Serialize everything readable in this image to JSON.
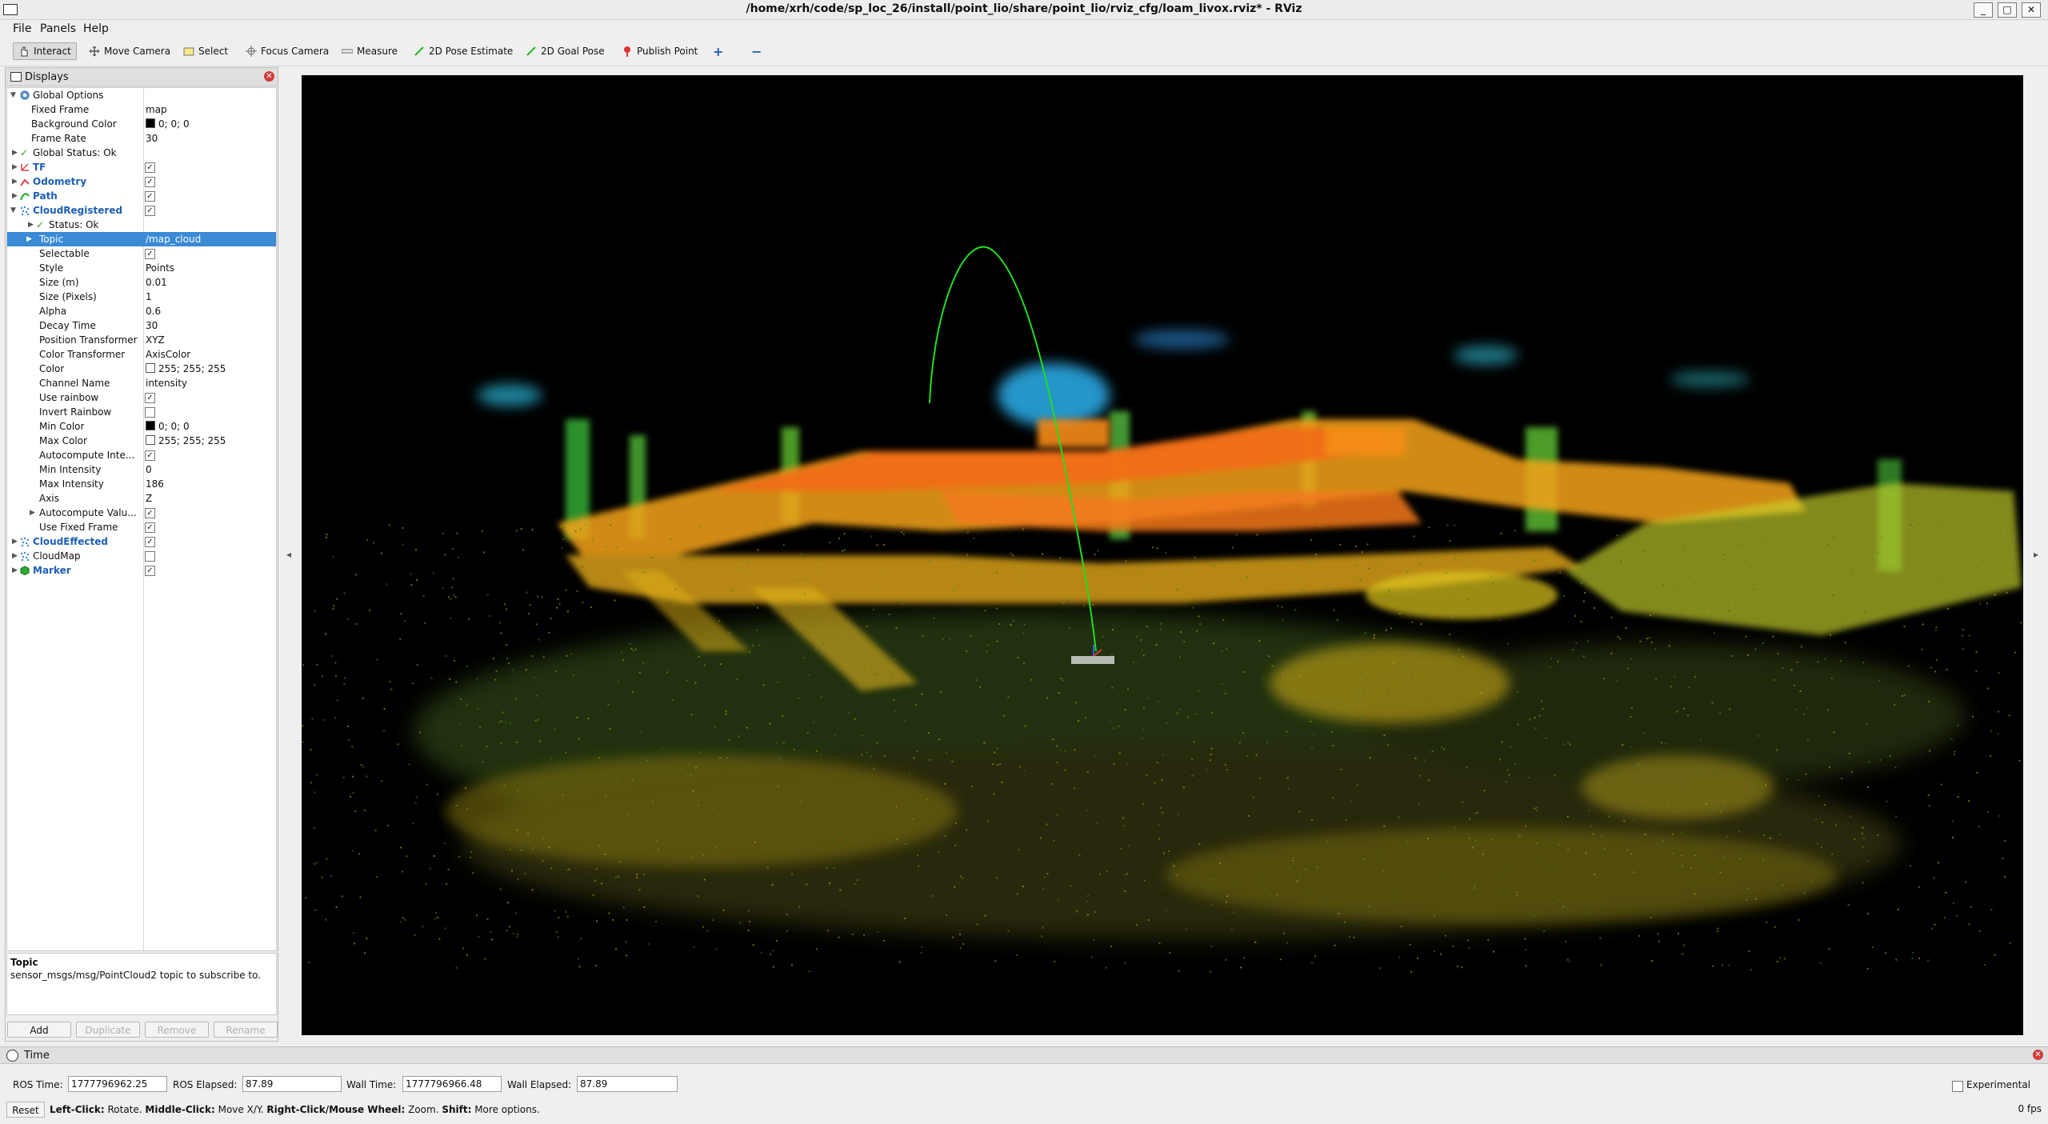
{
  "window": {
    "title": "/home/xrh/code/sp_loc_26/install/point_lio/share/point_lio/rviz_cfg/loam_livox.rviz* - RViz",
    "buttons": [
      "_",
      "□",
      "✕"
    ]
  },
  "menu": [
    "File",
    "Panels",
    "Help"
  ],
  "toolbar": {
    "interact": "Interact",
    "move_camera": "Move Camera",
    "select": "Select",
    "focus_camera": "Focus Camera",
    "measure": "Measure",
    "pose_estimate": "2D Pose Estimate",
    "goal_pose": "2D Goal Pose",
    "publish_point": "Publish Point",
    "add_tool": "+",
    "remove_tool": "−"
  },
  "displays": {
    "title": "Displays",
    "rows": [
      {
        "name": "Global Options",
        "value": ""
      },
      {
        "name": "Fixed Frame",
        "value": "map"
      },
      {
        "name": "Background Color",
        "value": "0; 0; 0"
      },
      {
        "name": "Frame Rate",
        "value": "30"
      },
      {
        "name": "Global Status: Ok",
        "value": ""
      },
      {
        "name": "TF",
        "value": "✓"
      },
      {
        "name": "Odometry",
        "value": "✓"
      },
      {
        "name": "Path",
        "value": "✓"
      },
      {
        "name": "CloudRegistered",
        "value": "✓"
      },
      {
        "name": "Status: Ok",
        "value": ""
      },
      {
        "name": "Topic",
        "value": "/map_cloud"
      },
      {
        "name": "Selectable",
        "value": "✓"
      },
      {
        "name": "Style",
        "value": "Points"
      },
      {
        "name": "Size (m)",
        "value": "0.01"
      },
      {
        "name": "Size (Pixels)",
        "value": "1"
      },
      {
        "name": "Alpha",
        "value": "0.6"
      },
      {
        "name": "Decay Time",
        "value": "30"
      },
      {
        "name": "Position Transformer",
        "value": "XYZ"
      },
      {
        "name": "Color Transformer",
        "value": "AxisColor"
      },
      {
        "name": "Color",
        "value": "255; 255; 255"
      },
      {
        "name": "Channel Name",
        "value": "intensity"
      },
      {
        "name": "Use rainbow",
        "value": "✓"
      },
      {
        "name": "Invert Rainbow",
        "value": ""
      },
      {
        "name": "Min Color",
        "value": "0; 0; 0"
      },
      {
        "name": "Max Color",
        "value": "255; 255; 255"
      },
      {
        "name": "Autocompute Inte...",
        "value": "✓"
      },
      {
        "name": "Min Intensity",
        "value": "0"
      },
      {
        "name": "Max Intensity",
        "value": "186"
      },
      {
        "name": "Axis",
        "value": "Z"
      },
      {
        "name": "Autocompute Valu...",
        "value": "✓"
      },
      {
        "name": "Use Fixed Frame",
        "value": "✓"
      },
      {
        "name": "CloudEffected",
        "value": "✓"
      },
      {
        "name": "CloudMap",
        "value": ""
      },
      {
        "name": "Marker",
        "value": "✓"
      }
    ],
    "help_title": "Topic",
    "help_text": "sensor_msgs/msg/PointCloud2 topic to subscribe to.",
    "buttons": {
      "add": "Add",
      "duplicate": "Duplicate",
      "remove": "Remove",
      "rename": "Rename"
    }
  },
  "time": {
    "title": "Time",
    "ros_time_label": "ROS Time:",
    "ros_time": "1777796962.25",
    "ros_elapsed_label": "ROS Elapsed:",
    "ros_elapsed": "87.89",
    "wall_time_label": "Wall Time:",
    "wall_time": "1777796966.48",
    "wall_elapsed_label": "Wall Elapsed:",
    "wall_elapsed": "87.89",
    "experimental": "Experimental",
    "reset": "Reset",
    "hint_left": "Left-Click:",
    "hint_left_text": " Rotate. ",
    "hint_middle": "Middle-Click:",
    "hint_middle_text": " Move X/Y. ",
    "hint_right": "Right-Click/Mouse Wheel:",
    "hint_right_text": " Zoom. ",
    "hint_shift": "Shift:",
    "hint_shift_text": " More options.",
    "fps": "0 fps"
  },
  "colors": {
    "selection": "#3a8ad6",
    "path": "#22dd22",
    "viewport_bg": "#000000"
  }
}
